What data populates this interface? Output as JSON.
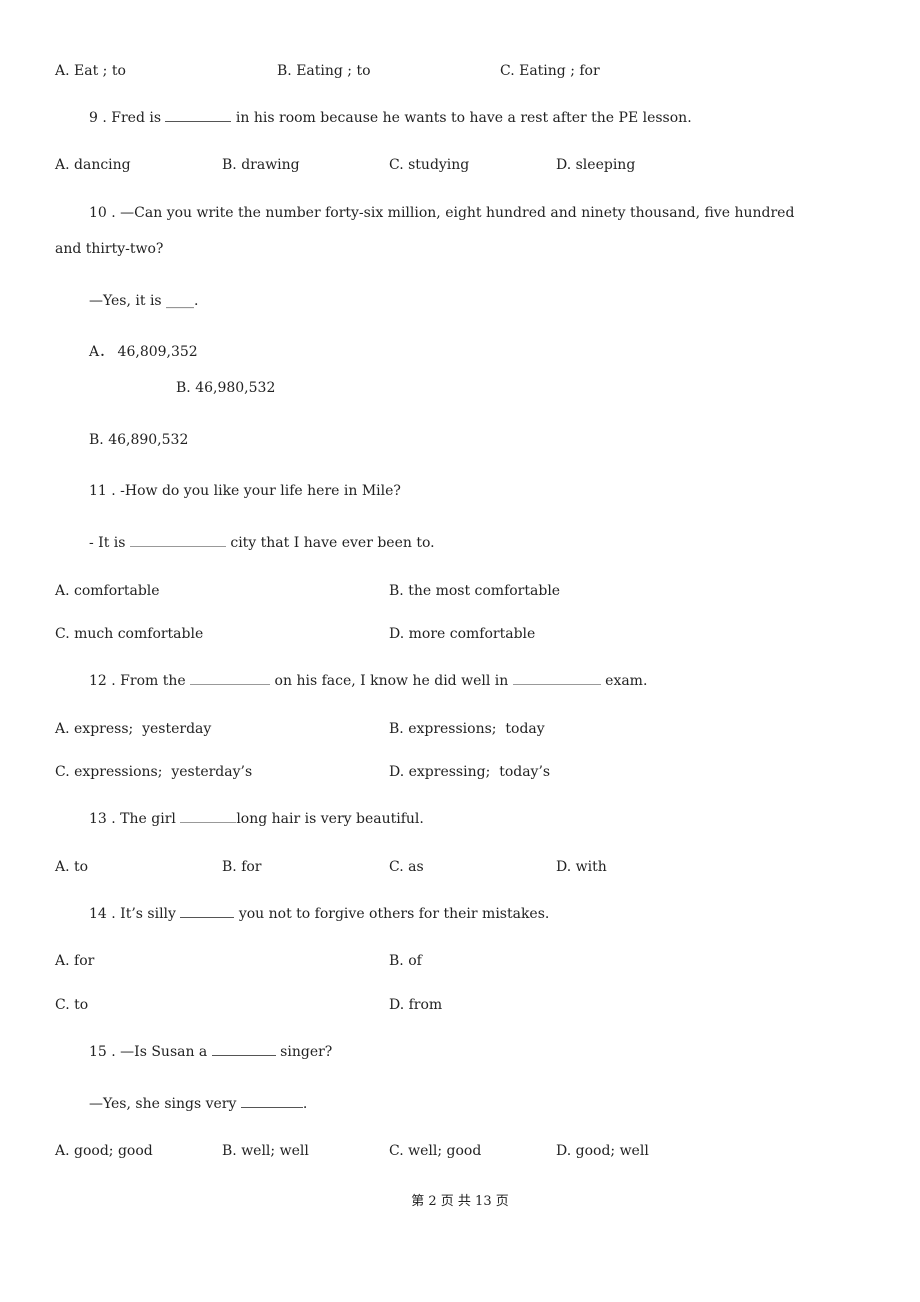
{
  "questions": {
    "q8_options": [
      "A. Eat ; to",
      "B. Eating ; to",
      "C. Eating ; for"
    ],
    "q9": {
      "stem_before": "9 . Fred is ",
      "blank": "________",
      "stem_after": " in his room because he wants to have a rest after the PE lesson.",
      "options": [
        "A. dancing",
        "B. drawing",
        "C. studying",
        "D. sleeping"
      ]
    },
    "q10": {
      "stem_line1": "10 . —Can you write the number forty-six million, eight hundred and ninety thousand, five hundred",
      "stem_line2": "and thirty-two?",
      "answer_line": "—Yes, it is ____.",
      "options": [
        "A． 46,809,352",
        "B. 46,980,532",
        "B. 46,890,532"
      ]
    },
    "q11": {
      "stem": "11 . -How do you like your life here in Mile?",
      "answer_before": "- It is ",
      "blank": "____________",
      "answer_after": " city that I have ever been to.",
      "options": [
        "A. comfortable",
        "B. the most comfortable",
        "C. much comfortable",
        "D. more comfortable"
      ]
    },
    "q12": {
      "stem_before": "12 . From the ",
      "blank1": "__________",
      "stem_middle": " on his face, I know he did well in ",
      "blank2": "___________",
      "stem_after": " exam.",
      "options": [
        "A. express;  yesterday",
        "B. expressions;  today",
        "C. expressions;  yesterday’s",
        "D. expressing;  today’s"
      ]
    },
    "q13": {
      "stem_before": "13 . The girl ",
      "blank": "_______",
      "stem_after": "long hair is very beautiful.",
      "options": [
        "A. to",
        "B. for",
        "C. as",
        "D. with"
      ]
    },
    "q14": {
      "stem_before": "14 . It’s silly ",
      "blank": "_______",
      "stem_after": " you not to forgive others for their mistakes.",
      "options": [
        "A. for",
        "B. of",
        "C. to",
        "D. from"
      ]
    },
    "q15": {
      "stem_before": "15 . —Is Susan a ",
      "blank": "________",
      "stem_after": " singer?",
      "answer_before": "—Yes, she sings very ",
      "answer_blank": "________",
      "answer_after": ".",
      "options": [
        "A. good; good",
        "B. well; well",
        "C. well; good",
        "D. good; well"
      ]
    }
  },
  "footer": {
    "page_label": "第 2 页 共 13 页"
  }
}
